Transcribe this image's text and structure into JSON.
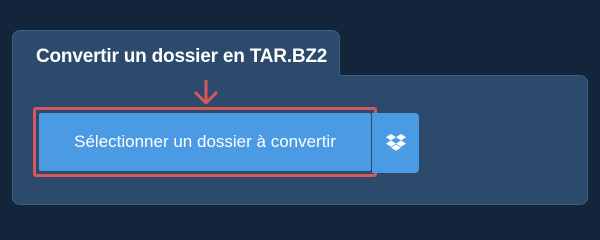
{
  "panel": {
    "title": "Convertir un dossier en TAR.BZ2"
  },
  "upload": {
    "select_folder_label": "Sélectionner un dossier à convertir",
    "dropbox_icon": "dropbox-icon"
  },
  "colors": {
    "background": "#13253a",
    "panel": "#2b4a6c",
    "button": "#4a9be3",
    "highlight": "#d9575a"
  }
}
